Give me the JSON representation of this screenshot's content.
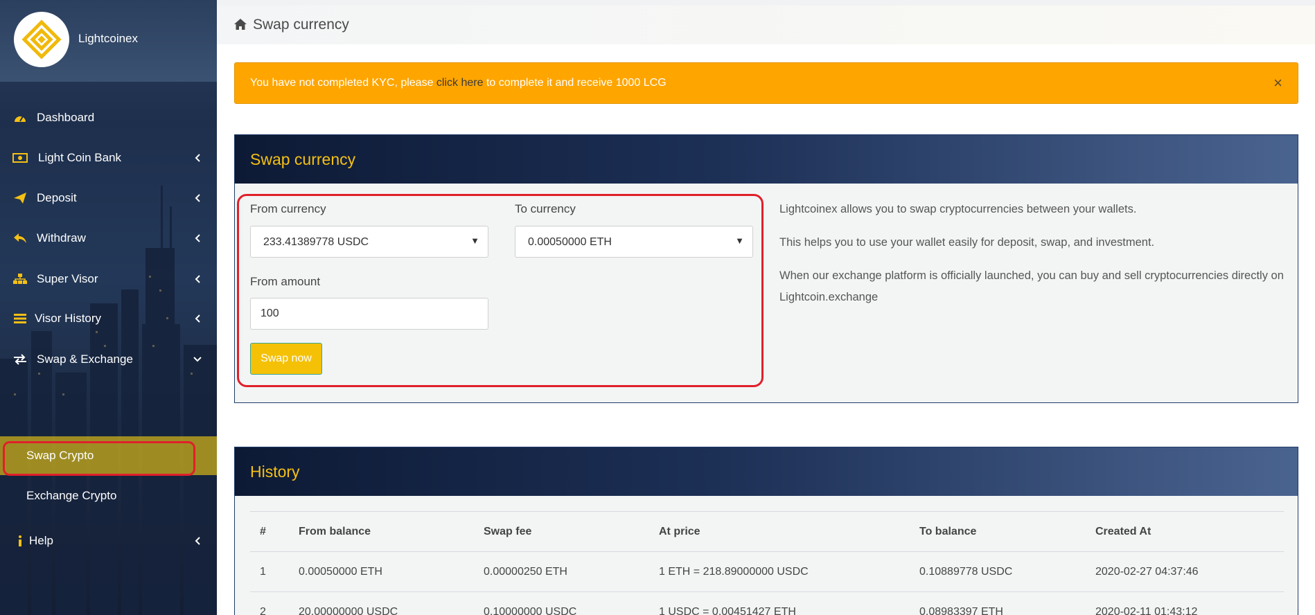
{
  "brand": {
    "name": "Lightcoinex"
  },
  "sidebar": {
    "items": [
      {
        "label": "Dashboard",
        "icon": "dashboard-icon",
        "has_chevron": false
      },
      {
        "label": "Light Coin Bank",
        "icon": "money-icon",
        "has_chevron": true
      },
      {
        "label": "Deposit",
        "icon": "paper-plane-icon",
        "has_chevron": true
      },
      {
        "label": "Withdraw",
        "icon": "reply-icon",
        "has_chevron": true
      },
      {
        "label": "Super Visor",
        "icon": "sitemap-icon",
        "has_chevron": true
      },
      {
        "label": "Visor History",
        "icon": "bars-icon",
        "has_chevron": true
      },
      {
        "label": "Swap & Exchange",
        "icon": "exchange-icon",
        "has_chevron": true,
        "expanded": true
      },
      {
        "label": "Help",
        "icon": "info-icon",
        "has_chevron": true
      }
    ],
    "sub_items": [
      {
        "label": "Swap Crypto",
        "active": true
      },
      {
        "label": "Exchange Crypto",
        "active": false
      }
    ]
  },
  "header": {
    "title": "Swap currency"
  },
  "alert": {
    "before": "You have not completed KYC, please ",
    "link": "click here",
    "after": " to complete it and receive 1000 LCG",
    "close": "×"
  },
  "swap": {
    "title": "Swap currency",
    "from_currency_label": "From currency",
    "from_currency_value": "233.41389778 USDC",
    "to_currency_label": "To currency",
    "to_currency_value": "0.00050000 ETH",
    "from_amount_label": "From amount",
    "from_amount_value": "100",
    "button": "Swap now",
    "info": [
      "Lightcoinex allows you to swap cryptocurrencies between your wallets.",
      "This helps you to use your wallet easily for deposit, swap, and investment.",
      "When our exchange platform is officially launched, you can buy and sell cryptocurrencies directly on Lightcoin.exchange"
    ]
  },
  "history": {
    "title": "History",
    "columns": [
      "#",
      "From balance",
      "Swap fee",
      "At price",
      "To balance",
      "Created At"
    ],
    "rows": [
      [
        "1",
        "0.00050000 ETH",
        "0.00000250 ETH",
        "1 ETH = 218.89000000 USDC",
        "0.10889778 USDC",
        "2020-02-27 04:37:46"
      ],
      [
        "2",
        "20.00000000 USDC",
        "0.10000000 USDC",
        "1 USDC = 0.00451427 ETH",
        "0.08983397 ETH",
        "2020-02-11 01:43:12"
      ]
    ]
  },
  "colors": {
    "accent": "#f5c014",
    "alert": "#ffa500",
    "highlight": "#e0202a",
    "active_sub": "#c5aa1c"
  }
}
